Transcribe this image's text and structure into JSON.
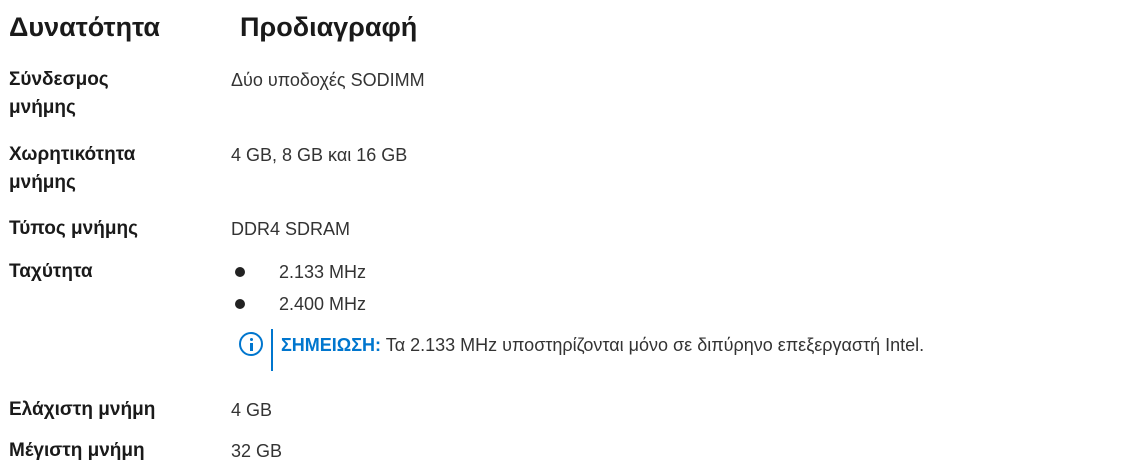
{
  "header": {
    "col1": "Δυνατότητα",
    "col2": "Προδιαγραφή"
  },
  "rows": [
    {
      "label_line1": "Σύνδεσμος",
      "label_line2": "μνήμης",
      "value": "Δύο υποδοχές SODIMM"
    },
    {
      "label_line1": "Χωρητικότητα",
      "label_line2": "μνήμης",
      "value": "4 GB, 8 GB και 16 GB"
    },
    {
      "label": "Τύπος μνήμης",
      "value": "DDR4 SDRAM"
    },
    {
      "label": "Ταχύτητα",
      "bullets": [
        "2.133 MHz",
        "2.400 MHz"
      ]
    },
    {
      "label": "Ελάχιστη μνήμη",
      "value": "4 GB"
    },
    {
      "label": "Μέγιστη μνήμη",
      "value": "32 GB"
    }
  ],
  "note": {
    "icon": "info-icon",
    "keyword": "ΣΗΜΕΙΩΣΗ:",
    "text": " Τα 2.133 MHz υποστηρίζονται μόνο σε διπύρηνο επεξεργαστή Intel."
  },
  "colors": {
    "accent": "#0076ce",
    "text": "#1a1a1a"
  }
}
